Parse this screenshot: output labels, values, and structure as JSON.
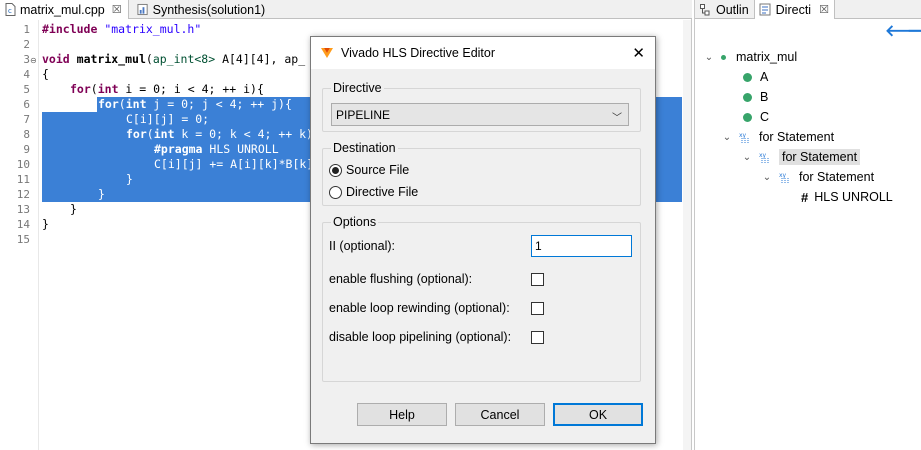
{
  "editor": {
    "tabs": [
      {
        "label": "matrix_mul.cpp",
        "close": "☒",
        "active": true
      },
      {
        "label": "Synthesis(solution1)",
        "active": false
      }
    ],
    "line_numbers": [
      "1",
      "2",
      "3",
      "4",
      "5",
      "6",
      "7",
      "8",
      "9",
      "10",
      "11",
      "12",
      "13",
      "14",
      "15"
    ],
    "code": {
      "l1_pp": "#include",
      "l1_str": "\"matrix_mul.h\"",
      "l3_kw": "void",
      "l3_fn": "matrix_mul",
      "l3_rest_a": "(",
      "l3_ty": "ap_int<8>",
      "l3_rest_b": " A[4][4], ap_",
      "l4": "{",
      "l5_kw": "for",
      "l5_a": "(",
      "l5_kw2": "int",
      "l5_b": " i = 0; i < 4; ++ i){",
      "l6_kw": "for",
      "l6_a": "(",
      "l6_kw2": "int",
      "l6_b": " j = 0; j < 4; ++ j){",
      "l7": "C[i][j] = 0;",
      "l8_kw": "for",
      "l8_a": "(",
      "l8_kw2": "int",
      "l8_b": " k = 0; k < 4; ++ k)",
      "l9_pp": "#pragma",
      "l9_b": " HLS UNROLL",
      "l10": "C[i][j] += A[i][k]*B[k]",
      "l11": "}",
      "l12": "}",
      "l13": "}",
      "l14": "}"
    }
  },
  "right_panel": {
    "tabs": [
      {
        "label": "Outlin"
      },
      {
        "label": "Directi",
        "close": "☒"
      }
    ],
    "tree": [
      {
        "label": "matrix_mul"
      },
      {
        "label": "A"
      },
      {
        "label": "B"
      },
      {
        "label": "C"
      },
      {
        "label": "for Statement"
      },
      {
        "label": "for Statement"
      },
      {
        "label": "for Statement"
      },
      {
        "label": "HLS UNROLL",
        "hash": "#"
      }
    ]
  },
  "dialog": {
    "title": "Vivado HLS Directive Editor",
    "directive_group": "Directive",
    "directive_value": "PIPELINE",
    "destination_group": "Destination",
    "dest_source": "Source File",
    "dest_directive": "Directive File",
    "options_group": "Options",
    "ii_label": "II (optional):",
    "ii_value": "1",
    "enable_flushing": "enable flushing (optional):",
    "enable_rewinding": "enable loop rewinding (optional):",
    "disable_pipelining": "disable loop pipelining (optional):",
    "help": "Help",
    "cancel": "Cancel",
    "ok": "OK"
  },
  "colors": {
    "selection": "#3b80d6",
    "accent": "#0078d7",
    "tree_dot": "#37a46a"
  }
}
